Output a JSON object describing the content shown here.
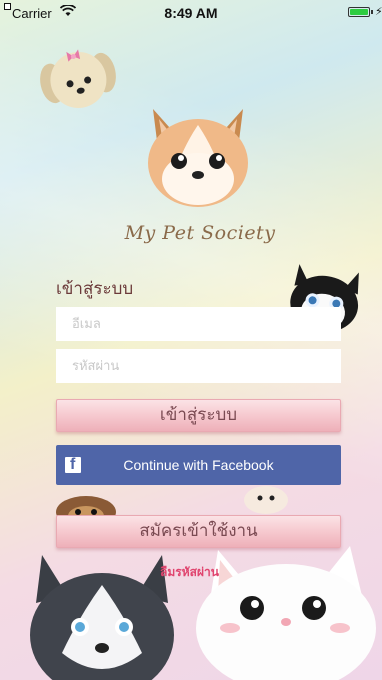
{
  "status_bar": {
    "carrier": "Carrier",
    "time": "8:49 AM",
    "battery_level": 0.9,
    "icons": [
      "wifi-icon",
      "battery-icon",
      "charging-icon"
    ]
  },
  "brand": {
    "name": "My Pet Society"
  },
  "login": {
    "heading": "เข้าสู่ระบบ",
    "email_placeholder": "อีเมล",
    "password_placeholder": "รหัสผ่าน",
    "login_button": "เข้าสู่ระบบ",
    "facebook_button": "Continue with Facebook",
    "signup_button": "สมัครเข้าใช้งาน",
    "forgot_password": "ลืมรหัสผ่าน"
  },
  "colors": {
    "facebook_blue": "#4f65a8",
    "pink_accent": "#e0446e",
    "brand_text": "#8a6a4a"
  }
}
